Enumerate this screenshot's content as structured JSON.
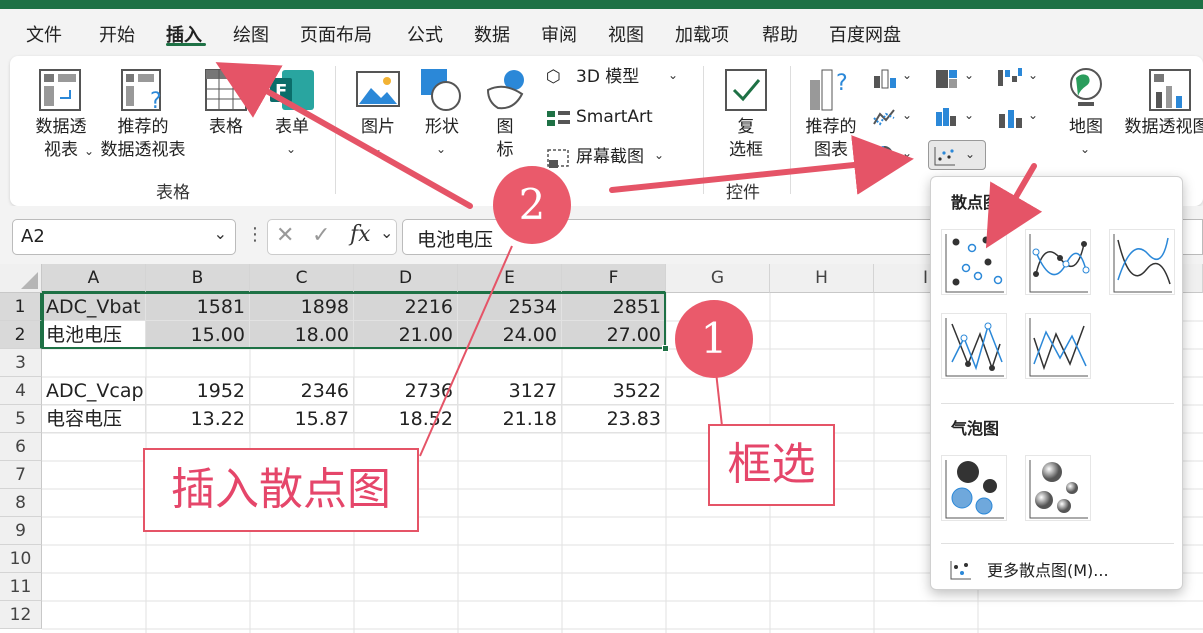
{
  "ribbon_tabs": [
    "文件",
    "开始",
    "插入",
    "绘图",
    "页面布局",
    "公式",
    "数据",
    "审阅",
    "视图",
    "加载项",
    "帮助",
    "百度网盘"
  ],
  "active_tab": "插入",
  "ribbon": {
    "pivot_table": [
      "数据透",
      "视表"
    ],
    "recommended_pivot": [
      "推荐的",
      "数据透视表"
    ],
    "table": "表格",
    "forms": "表单",
    "pictures": "图片",
    "shapes": "形状",
    "icons": [
      "图",
      "标"
    ],
    "model3d": "3D 模型",
    "smartart": "SmartArt",
    "screenshot": "屏幕截图",
    "checkbox": [
      "复",
      "选框"
    ],
    "recommended_charts": [
      "推荐的",
      "图表"
    ],
    "map": "地图",
    "pivot_chart": "数据透视图",
    "group_tables": "表格",
    "group_controls": "控件"
  },
  "name_box": "A2",
  "formula_bar": "电池电压",
  "columns": [
    "A",
    "B",
    "C",
    "D",
    "E",
    "F",
    "G",
    "H",
    "I"
  ],
  "rows": [
    "1",
    "2",
    "3",
    "4",
    "5",
    "6",
    "7",
    "8",
    "9",
    "10",
    "11",
    "12"
  ],
  "cells": {
    "r1": [
      "ADC_Vbat",
      "1581",
      "1898",
      "2216",
      "2534",
      "2851"
    ],
    "r2": [
      "电池电压",
      "15.00",
      "18.00",
      "21.00",
      "24.00",
      "27.00"
    ],
    "r4": [
      "ADC_Vcap",
      "1952",
      "2346",
      "2736",
      "3127",
      "3522"
    ],
    "r5": [
      "电容电压",
      "13.22",
      "15.87",
      "18.52",
      "21.18",
      "23.83"
    ]
  },
  "dropdown": {
    "scatter_title": "散点图",
    "bubble_title": "气泡图",
    "more": "更多散点图(M)..."
  },
  "annotations": {
    "step1": "1",
    "step2": "2",
    "label_select": "框选",
    "label_insert": "插入散点图"
  },
  "colors": {
    "accent": "#1e7145",
    "annotation": "#e55467"
  }
}
